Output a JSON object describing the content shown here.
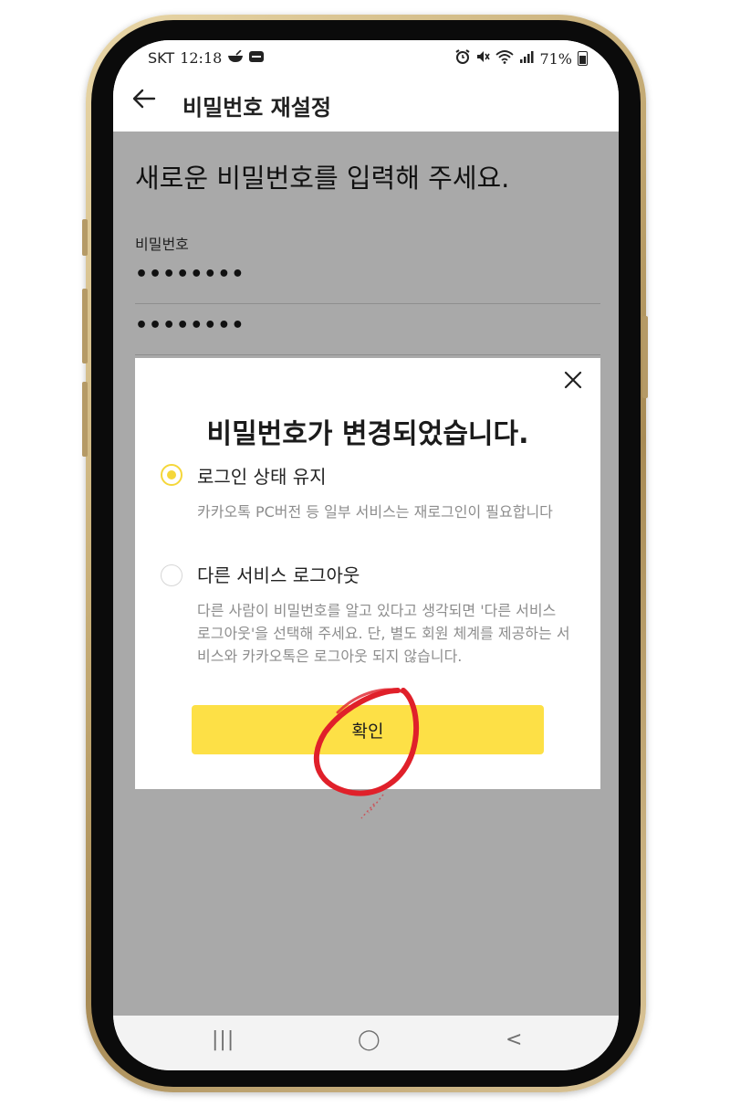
{
  "status_bar": {
    "carrier": "SKT",
    "time": "12:18",
    "battery": "71%",
    "icons": [
      "food-bowl-icon",
      "notification-badge-icon",
      "alarm-icon",
      "mute-icon",
      "wifi-icon",
      "signal-icon",
      "battery-icon"
    ]
  },
  "app_bar": {
    "back_icon": "back-arrow-icon",
    "title": "비밀번호 재설정"
  },
  "content": {
    "heading": "새로운 비밀번호를 입력해 주세요.",
    "password_label": "비밀번호",
    "password_value": "••••••••",
    "confirm_value": "••••••••"
  },
  "dialog": {
    "close_icon": "close-icon",
    "title": "비밀번호가 변경되었습니다.",
    "options": [
      {
        "label": "로그인 상태 유지",
        "selected": true,
        "description": "카카오톡 PC버전 등 일부 서비스는 재로그인이 필요합니다"
      },
      {
        "label": "다른 서비스 로그아웃",
        "selected": false,
        "description": "다른 사람이 비밀번호를 알고 있다고 생각되면 '다른 서비스 로그아웃'을 선택해 주세요. 단, 별도 회원 체계를 제공하는 서비스와 카카오톡은 로그아웃 되지 않습니다."
      }
    ],
    "confirm_label": "확인"
  },
  "nav_bar": {
    "recents": "|||",
    "home": "◯",
    "back": "<"
  },
  "colors": {
    "accent_yellow": "#fde046",
    "radio_yellow": "#f5d73a",
    "overlay_gray": "#a9a9a9",
    "annotation_red": "#e0202a"
  }
}
